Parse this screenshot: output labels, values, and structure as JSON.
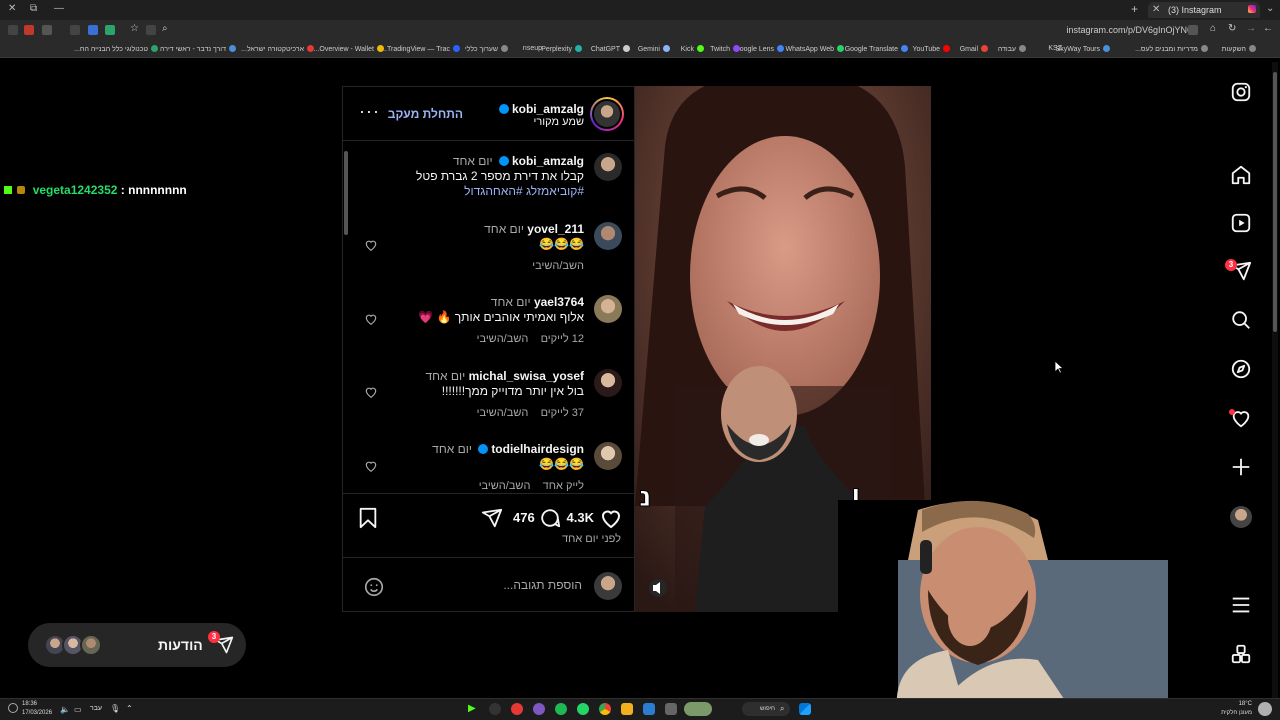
{
  "browser": {
    "tab_title": "(3) Instagram",
    "url": "instagram.com/p/DV6gInOjYN6",
    "bookmarks": [
      "השקעות",
      "מדריות ומבנים לעס...",
      "SkyWay Tours",
      "KSZ",
      "עבודה",
      "Gmail",
      "YouTube",
      "Google Translate",
      "WhatsApp Web",
      "Google Lens",
      "Twitch",
      "Kick",
      "Gemini",
      "ChatGPT",
      "Perplexity",
      "nseup",
      "שערוך כללי",
      "TradingView — Trac...",
      "Overview - Wallet...",
      "ארכיטקטורה ישראל...",
      "דורך נדבר - ראשי דירה",
      "טכנולוגי כלל הבנייה הח..."
    ]
  },
  "chat": {
    "username": "vegeta1242352",
    "separator": " : ",
    "message": "nnnnnnnn"
  },
  "post": {
    "author": "kobi_amzalg",
    "author_subtitle": "שמע מקורי",
    "follow_label": "התחלת מעקב",
    "caption": {
      "username": "kobi_amzalg",
      "time": "יום אחד",
      "text": "קבלו את דירת מספר 2 גברת פטל",
      "hashtags": "#קוביאמזלג #האחהגדול"
    },
    "comments": [
      {
        "username": "yovel_211",
        "time": "יום אחד",
        "text": "😂😂😂",
        "likes": "",
        "reply": "השב/השיבי"
      },
      {
        "username": "yael3764",
        "time": "יום אחד",
        "text": "אלוף ואמיתי אוהבים אותך 🔥 💗",
        "likes": "12 לייקים",
        "reply": "השב/השיבי"
      },
      {
        "username": "michal_swisa_yosef",
        "time": "יום אחד",
        "text": "בול אין יותר מדוייק ממך!!!!!!!",
        "likes": "37 לייקים",
        "reply": "השב/השיבי"
      },
      {
        "username": "todielhairdesign",
        "time": "יום אחד",
        "text": "😂😂😂",
        "likes": "לייק אחד",
        "reply": "השב/השיבי"
      }
    ],
    "likes_count": "4.3K",
    "comments_count": "476",
    "posted_time": "לפני יום אחד",
    "add_comment_placeholder": "הוספת תגובה..."
  },
  "sidebar": {
    "messages_badge": "3"
  },
  "notifications": {
    "label": "הודעות",
    "badge": "3"
  },
  "taskbar": {
    "time": "18:36",
    "date": "17/03/2026",
    "lang": "עבר",
    "search": "חיפוש",
    "weather_temp": "18°C",
    "weather_desc": "מעונן חלקית"
  },
  "colors": {
    "background": "#000000",
    "verified": "#0095f6",
    "badge": "#ff3040",
    "follow": "#9ab4f5",
    "chat_user": "#22dd66"
  }
}
